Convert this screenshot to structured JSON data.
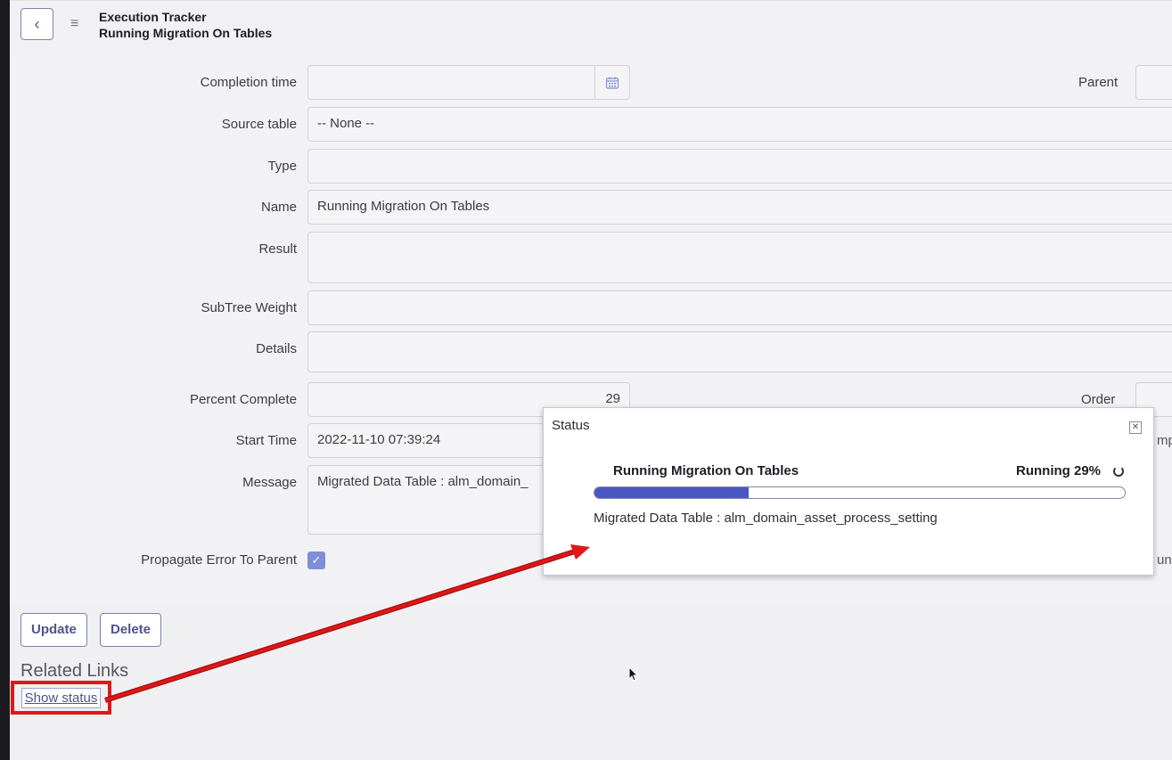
{
  "header": {
    "back_icon": "chevron-left-icon",
    "menu_icon": "hamburger-icon",
    "record_type": "Execution Tracker",
    "record_name": "Running Migration On Tables"
  },
  "form": {
    "completion_time": {
      "label": "Completion time",
      "value": ""
    },
    "parent": {
      "label": "Parent",
      "value": ""
    },
    "source_table": {
      "label": "Source table",
      "value": "-- None --"
    },
    "type": {
      "label": "Type",
      "value": ""
    },
    "name": {
      "label": "Name",
      "value": "Running Migration On Tables"
    },
    "result": {
      "label": "Result",
      "value": ""
    },
    "subtree_weight": {
      "label": "SubTree Weight",
      "value": ""
    },
    "details": {
      "label": "Details",
      "value": ""
    },
    "percent_complete": {
      "label": "Percent Complete",
      "value": "29"
    },
    "order": {
      "label": "Order",
      "value": ""
    },
    "start_time": {
      "label": "Start Time",
      "value": "2022-11-10 07:39:24"
    },
    "message": {
      "label": "Message",
      "value": "Migrated Data Table : alm_domain_"
    },
    "propagate_error": {
      "label": "Propagate Error To Parent",
      "checked": true
    },
    "right_partial_1": "mp",
    "right_partial_2": "un"
  },
  "actions": {
    "update_label": "Update",
    "delete_label": "Delete"
  },
  "related_links": {
    "heading": "Related Links",
    "show_status": "Show status"
  },
  "status_modal": {
    "title": "Status",
    "task_name": "Running Migration On Tables",
    "status_text": "Running 29%",
    "progress": 0.29,
    "message": "Migrated Data Table : alm_domain_asset_process_setting"
  },
  "colors": {
    "accent": "#4e558a",
    "progress": "#4a57c3",
    "highlight": "#e01818"
  }
}
